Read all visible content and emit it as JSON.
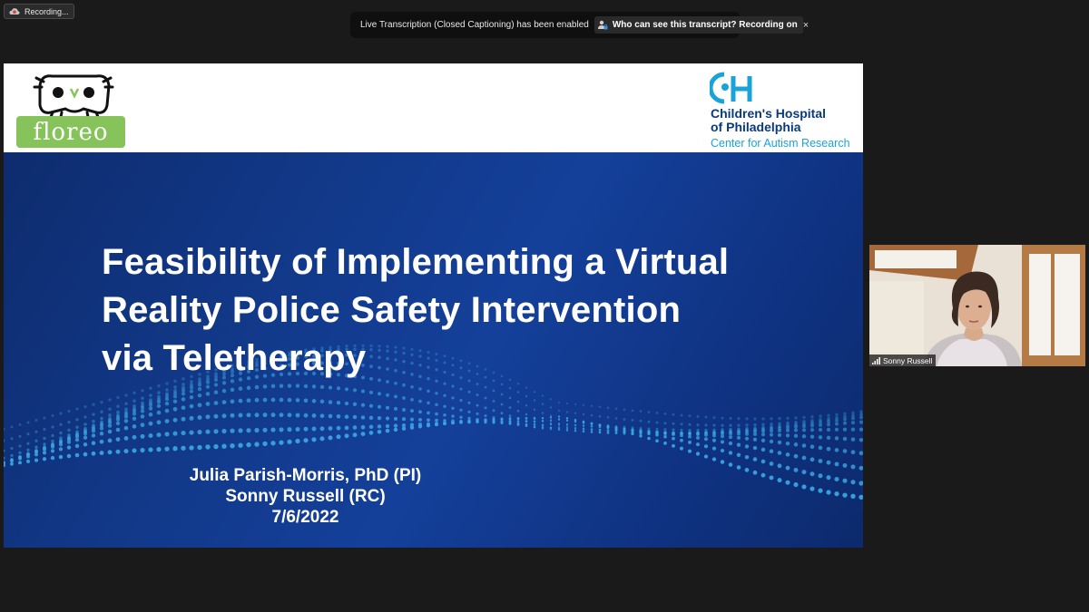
{
  "recording": {
    "label": "Recording..."
  },
  "transcription_banner": {
    "message": "Live Transcription (Closed Captioning) has been enabled",
    "link_label": "Who can see this transcript? Recording on",
    "close_label": "×"
  },
  "slide": {
    "logos": {
      "left_text": "floreo",
      "right_name_line1": "Children's Hospital",
      "right_name_line2": "of Philadelphia",
      "right_sub": "Center for Autism Research"
    },
    "title_lines": [
      "Feasibility of Implementing a Virtual",
      "Reality Police Safety Intervention",
      "via Teletherapy"
    ],
    "authors": [
      "Julia Parish-Morris, PhD (PI)",
      "Sonny Russell (RC)",
      "7/6/2022"
    ]
  },
  "participant": {
    "name": "Sonny Russell"
  },
  "colors": {
    "slide_blue": "#123a8c",
    "dot_blue": "#3aa3e0",
    "floreo_green": "#86c35a",
    "chop_navy": "#0a3a7a",
    "chop_cyan": "#1aa3d9"
  }
}
